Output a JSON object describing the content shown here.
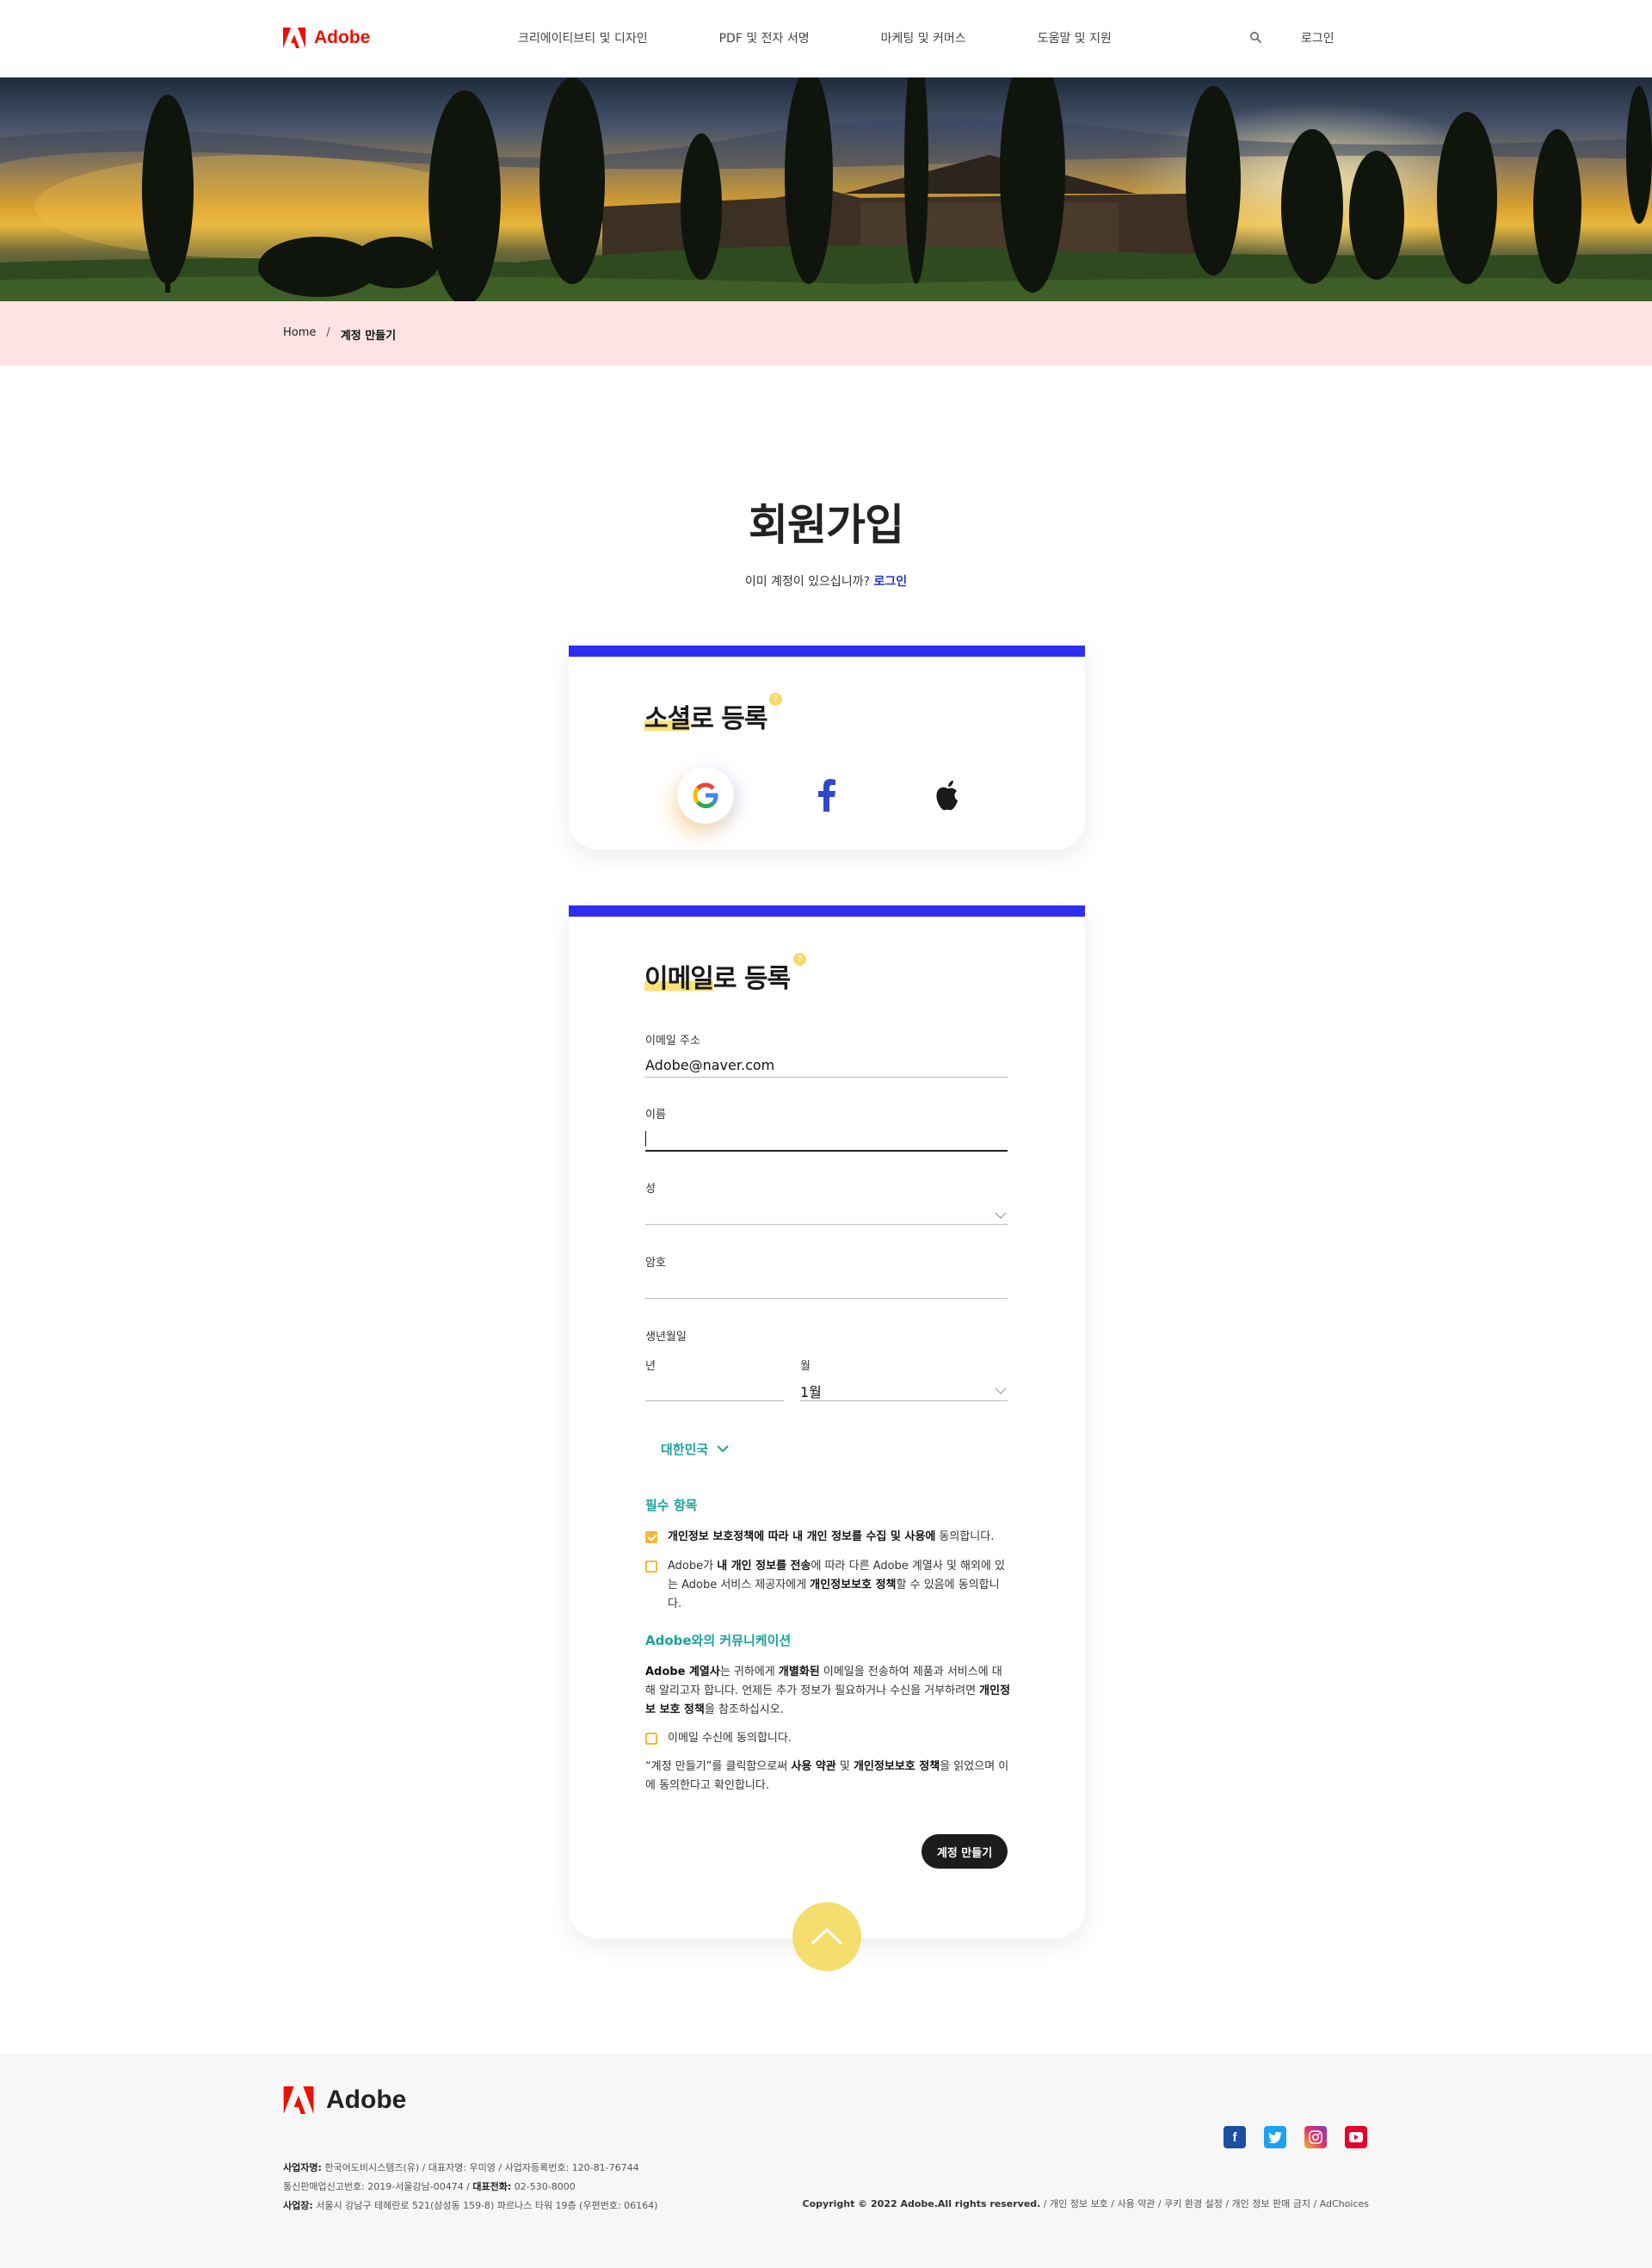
{
  "header": {
    "brand": "Adobe",
    "nav": [
      "크리에이티브티 및 디자인",
      "PDF 및 전자 서명",
      "마케팅 및 커머스",
      "도움말 및 지원"
    ],
    "login": "로그인"
  },
  "breadcrumb": {
    "home": "Home",
    "separator": "/",
    "current": "계정 만들기"
  },
  "page": {
    "title": "회원가입",
    "subtitle_prefix": "이미 계정이 있으십니까?",
    "subtitle_link": "로그인"
  },
  "social": {
    "title_hl": "소셜",
    "title_rest": "로 등록",
    "badge": "?",
    "buttons": [
      "google-icon",
      "facebook-icon",
      "apple-icon"
    ]
  },
  "email_form": {
    "title_hl": "이메일",
    "title_rest": "로 등록",
    "badge": "?",
    "email_label": "이메일 주소",
    "email_value": "Adobe@naver.com",
    "first_name_label": "이름",
    "last_name_label": "성",
    "password_label": "암호",
    "birth_label": "생년월일",
    "year_label": "년",
    "month_label": "월",
    "month_value": "1월",
    "country": "대한민국",
    "required_heading": "필수 항목",
    "consent1": {
      "checked": true,
      "b1": "개인정보 보호정책에 따라 내 개인 정보를 수집 및 사용에",
      "t1": " 동의합니다."
    },
    "consent2": {
      "checked": false,
      "t1": "Adobe가 ",
      "b1": "내 개인 정보를 전송",
      "t2": "에 따라 다른 Adobe 계열사 및 해외에 있는 Adobe 서비스 제공자에게 ",
      "b2": "개인정보보호 정책",
      "t3": "할 수 있음에 동의합니다."
    },
    "comm_heading": "Adobe와의 커뮤니케이션",
    "comm_para": {
      "b1": "Adobe 계열사",
      "t1": "는 귀하에게 ",
      "b2": "개별화된",
      "t2": " 이메일을 전송하여 제품과 서비스에 대해 알리고자 합니다. 언제든 추가 정보가 필요하거나 수신을 거부하려면 ",
      "b3": "개인정보 보호 정책",
      "t3": "을 참조하십시오."
    },
    "consent3": {
      "checked": false,
      "t1": "이메일 수신에 동의합니다."
    },
    "terms": {
      "t1": "“계정 만들기”를 클릭함으로써 ",
      "b1": "사용 약관",
      "t2": " 및 ",
      "b2": "개인정보보호 정책",
      "t3": "을 읽었으며 이에 동의한다고 확인합니다."
    },
    "submit": "계정 만들기"
  },
  "footer": {
    "brand": "Adobe",
    "line1": {
      "b": "사업자명:",
      "t": " 한국어도비시스템즈(유) / 대표자명: 우미영 / 사업자등록번호: 120-81-76744"
    },
    "line2": {
      "t1": "통신판매업신고번호: 2019-서울강남-00474 / ",
      "b": "대표전화:",
      "t2": " 02-530-8000"
    },
    "line3": {
      "b": "사업장:",
      "t": " 서울시 강남구 테헤란로 521(삼성동 159-8) 파르나스 타워 19층 (우편번호: 06164)"
    },
    "copyright_b": "Copyright © 2022 Adobe.All rights reserved.",
    "copyright_t": " / 개인 정보 보호 / 사용 약관 / 쿠키 환경 설정 / 개인 정보 판매 금지 / AdChoices",
    "social_icons": [
      "facebook-icon",
      "twitter-icon",
      "instagram-icon",
      "youtube-icon"
    ],
    "social_colors": [
      "#1b4fa0",
      "#1da1f2",
      "#c13584",
      "#e4002b"
    ]
  }
}
